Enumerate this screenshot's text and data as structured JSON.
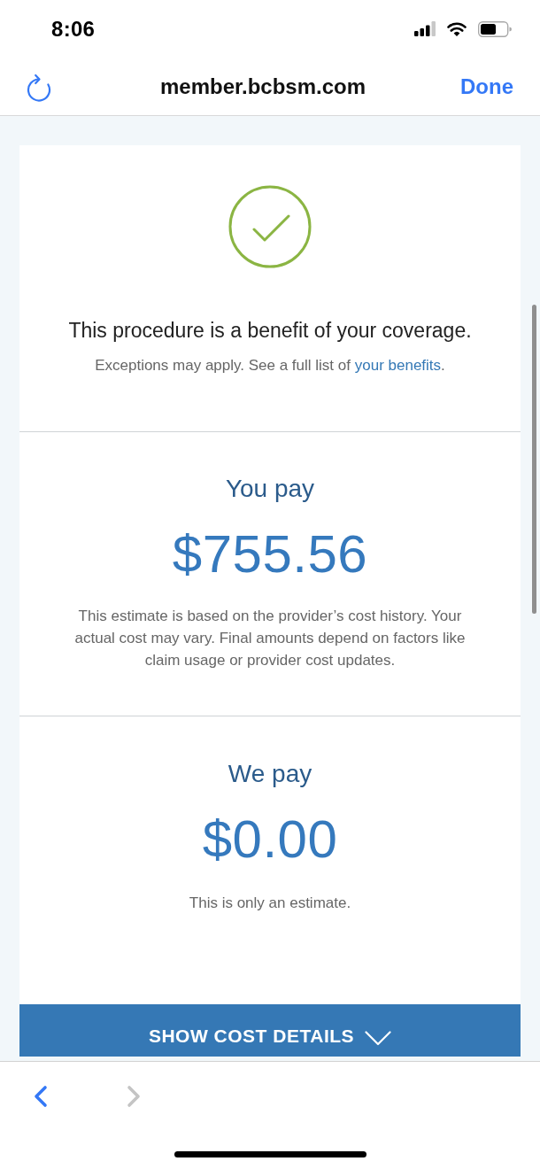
{
  "status_bar": {
    "time": "8:06"
  },
  "browser_bar": {
    "url": "member.bcbsm.com",
    "done_label": "Done"
  },
  "coverage": {
    "title": "This procedure is a benefit of your coverage.",
    "note": "Exceptions may apply. See a full list of",
    "link": "your benefits",
    "note_end": "."
  },
  "you_pay": {
    "label": "You pay",
    "amount": "$755.56",
    "note": "This estimate is based on the provider’s cost history. Your actual cost may vary. Final amounts depend on factors like claim usage or provider cost updates."
  },
  "we_pay": {
    "label": "We pay",
    "amount": "$0.00",
    "note": "This is only an estimate."
  },
  "details_button": {
    "label": "SHOW COST DETAILS",
    "expanded": false
  },
  "toolbar": {
    "buttons": [
      {
        "kind": "back",
        "disabled": false
      },
      {
        "kind": "forward",
        "disabled": true
      }
    ]
  }
}
